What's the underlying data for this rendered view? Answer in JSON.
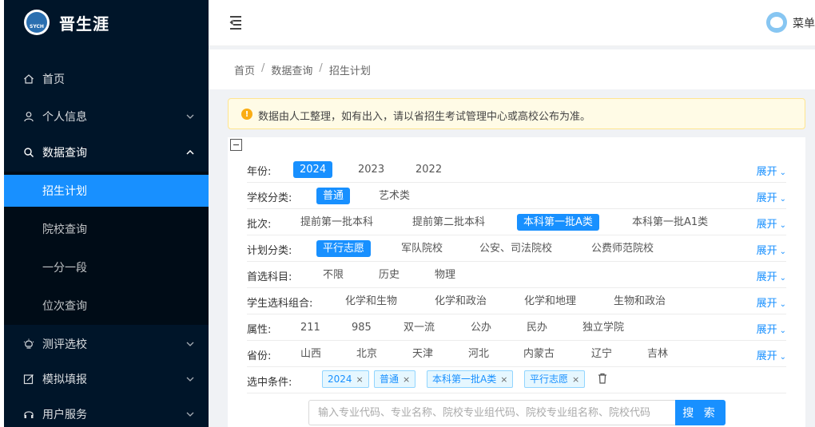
{
  "brand": {
    "name": "晋生涯",
    "logo_text": "SYCH"
  },
  "sidebar": {
    "items": [
      {
        "label": "首页",
        "icon": "home-icon"
      },
      {
        "label": "个人信息",
        "icon": "user-icon"
      },
      {
        "label": "数据查询",
        "icon": "search-icon"
      },
      {
        "label": "测评选校",
        "icon": "bulb-icon"
      },
      {
        "label": "模拟填报",
        "icon": "form-icon"
      },
      {
        "label": "用户服务",
        "icon": "headset-icon"
      }
    ],
    "submenu": [
      {
        "label": "招生计划",
        "active": true
      },
      {
        "label": "院校查询"
      },
      {
        "label": "一分一段"
      },
      {
        "label": "位次查询"
      }
    ]
  },
  "header": {
    "user_name": "菜单"
  },
  "breadcrumb": [
    "首页",
    "数据查询",
    "招生计划"
  ],
  "alert": {
    "text": "数据由人工整理，如有出入，请以省招生考试管理中心或高校公布为准。"
  },
  "filters": {
    "expand_label": "展开",
    "rows": [
      {
        "label": "年份:",
        "options": [
          "2024",
          "2023",
          "2022"
        ],
        "selected": 0
      },
      {
        "label": "学校分类:",
        "options": [
          "普通",
          "艺术类"
        ],
        "selected": 0
      },
      {
        "label": "批次:",
        "options": [
          "提前第一批本科",
          "提前第二批本科",
          "本科第一批A类",
          "本科第一批A1类"
        ],
        "selected": 2
      },
      {
        "label": "计划分类:",
        "options": [
          "平行志愿",
          "军队院校",
          "公安、司法院校",
          "公费师范院校"
        ],
        "selected": 0
      },
      {
        "label": "首选科目:",
        "options": [
          "不限",
          "历史",
          "物理"
        ],
        "selected": -1
      },
      {
        "label": "学生选科组合:",
        "options": [
          "化学和生物",
          "化学和政治",
          "化学和地理",
          "生物和政治"
        ],
        "selected": -1
      },
      {
        "label": "属性:",
        "options": [
          "211",
          "985",
          "双一流",
          "公办",
          "民办",
          "独立学院"
        ],
        "selected": -1
      },
      {
        "label": "省份:",
        "options": [
          "山西",
          "北京",
          "天津",
          "河北",
          "内蒙古",
          "辽宁",
          "吉林"
        ],
        "selected": -1
      }
    ],
    "selected_label": "选中条件:",
    "selected_tags": [
      "2024",
      "普通",
      "本科第一批A类",
      "平行志愿"
    ]
  },
  "search": {
    "placeholder": "输入专业代码、专业名称、院校专业组代码、院校专业组名称、院校代码",
    "button_label": "搜 索"
  },
  "colors": {
    "primary": "#1890ff",
    "sidebar_bg": "#001529",
    "alert_bg": "#fffbe6"
  }
}
